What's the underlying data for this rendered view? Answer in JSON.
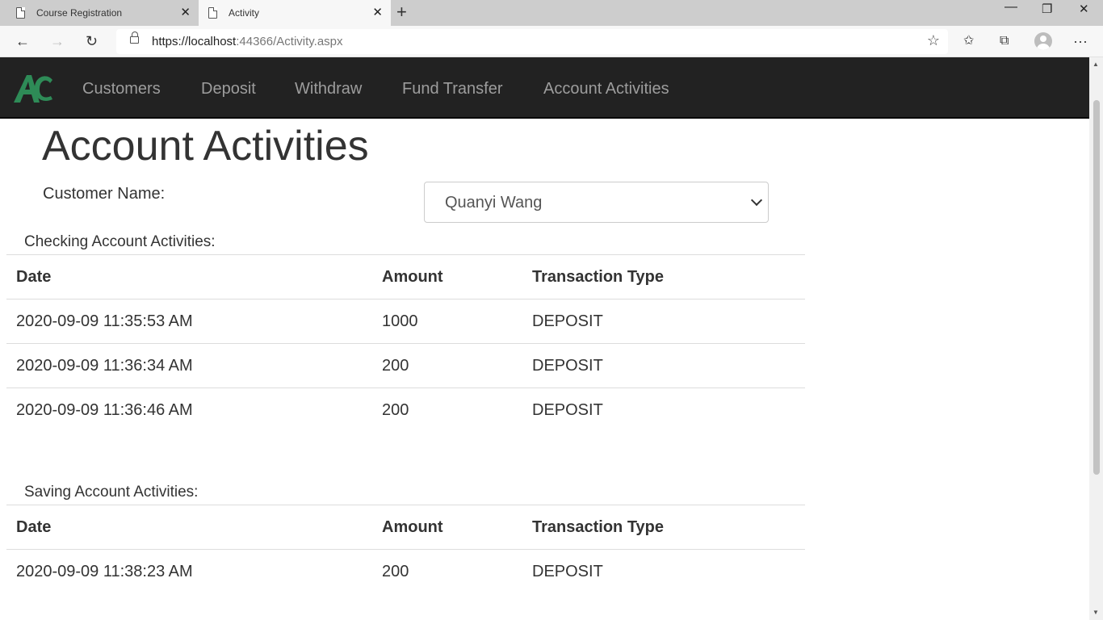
{
  "browser": {
    "tabs": [
      {
        "title": "Course Registration"
      },
      {
        "title": "Activity"
      }
    ],
    "url_host": "https://localhost",
    "url_rest": ":44366/Activity.aspx"
  },
  "navbar": {
    "brand": "AC",
    "links": [
      "Customers",
      "Deposit",
      "Withdraw",
      "Fund Transfer",
      "Account Activities"
    ]
  },
  "page": {
    "title": "Account Activities",
    "customer_label": "Customer Name:",
    "customer_selected": "Quanyi Wang"
  },
  "checking": {
    "caption": "Checking Account Activities:",
    "headers": [
      "Date",
      "Amount",
      "Transaction Type"
    ],
    "rows": [
      [
        "2020-09-09 11:35:53 AM",
        "1000",
        "DEPOSIT"
      ],
      [
        "2020-09-09 11:36:34 AM",
        "200",
        "DEPOSIT"
      ],
      [
        "2020-09-09 11:36:46 AM",
        "200",
        "DEPOSIT"
      ]
    ]
  },
  "saving": {
    "caption": "Saving Account Activities:",
    "headers": [
      "Date",
      "Amount",
      "Transaction Type"
    ],
    "rows": [
      [
        "2020-09-09 11:38:23 AM",
        "200",
        "DEPOSIT"
      ]
    ]
  },
  "colors": {
    "navbar_bg": "#222222",
    "nav_link": "#9d9d9d",
    "logo_green": "#2e8b57",
    "text": "#333333"
  }
}
